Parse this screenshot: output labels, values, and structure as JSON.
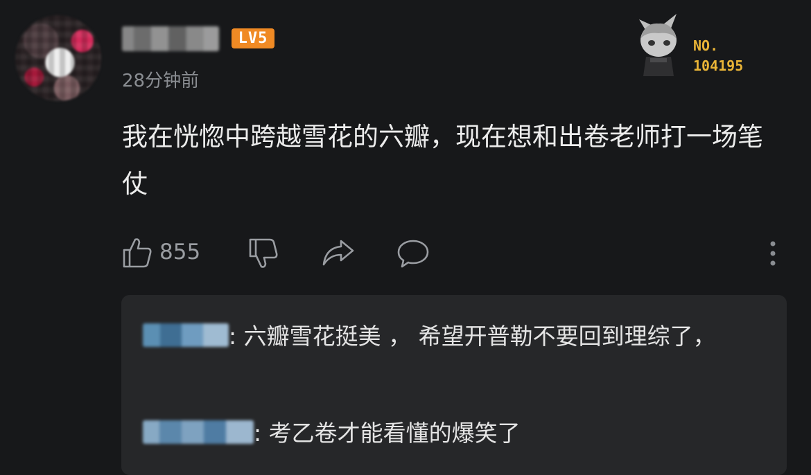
{
  "post": {
    "username": "blurred-user",
    "level_badge": "LV5",
    "timestamp": "28分钟前",
    "fan_badge": {
      "label": "NO.",
      "number": "104195"
    },
    "content": "我在恍惚中跨越雪花的六瓣，现在想和出卷老师打一场笔仗",
    "likes": "855",
    "icons": [
      "thumbs-up-icon",
      "thumbs-down-icon",
      "share-icon",
      "comment-icon",
      "more-icon"
    ]
  },
  "replies": [
    {
      "user": "blurred-reply-user-1",
      "text": ": 六瓣雪花挺美 ， 希望开普勒不要回到理综了，"
    },
    {
      "user": "blurred-reply-user-2",
      "text": ": 考乙卷才能看懂的爆笑了"
    }
  ],
  "colors": {
    "background": "#17181a",
    "reply_bg": "#262729",
    "level": "#f08a24",
    "badge": "#e9b437",
    "muted": "#8a8d92"
  }
}
